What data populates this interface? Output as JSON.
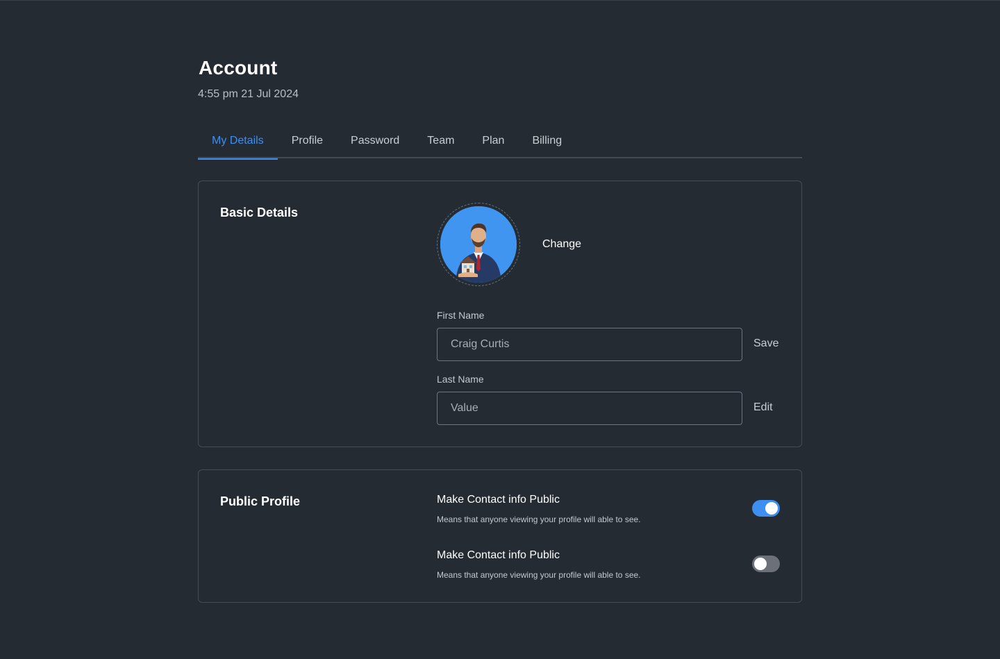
{
  "header": {
    "title": "Account",
    "timestamp": "4:55 pm 21 Jul 2024"
  },
  "tabs": [
    {
      "label": "My Details",
      "active": true
    },
    {
      "label": "Profile",
      "active": false
    },
    {
      "label": "Password",
      "active": false
    },
    {
      "label": "Team",
      "active": false
    },
    {
      "label": "Plan",
      "active": false
    },
    {
      "label": "Billing",
      "active": false
    }
  ],
  "basic_details": {
    "title": "Basic Details",
    "change_label": "Change",
    "first_name": {
      "label": "First Name",
      "value": "Craig Curtis",
      "action": "Save"
    },
    "last_name": {
      "label": "Last Name",
      "placeholder": "Value",
      "action": "Edit"
    }
  },
  "public_profile": {
    "title": "Public Profile",
    "settings": [
      {
        "title": "Make Contact info Public",
        "description": "Means that anyone viewing your profile will able to see.",
        "enabled": true
      },
      {
        "title": "Make Contact info Public",
        "description": "Means that anyone viewing your profile will able to see.",
        "enabled": false
      }
    ]
  },
  "colors": {
    "background": "#252b33",
    "accent": "#3d8ff0",
    "border": "#454c56",
    "toggle_off": "#6b7079"
  },
  "icons": {
    "avatar": "profile-photo-man-holding-house"
  }
}
